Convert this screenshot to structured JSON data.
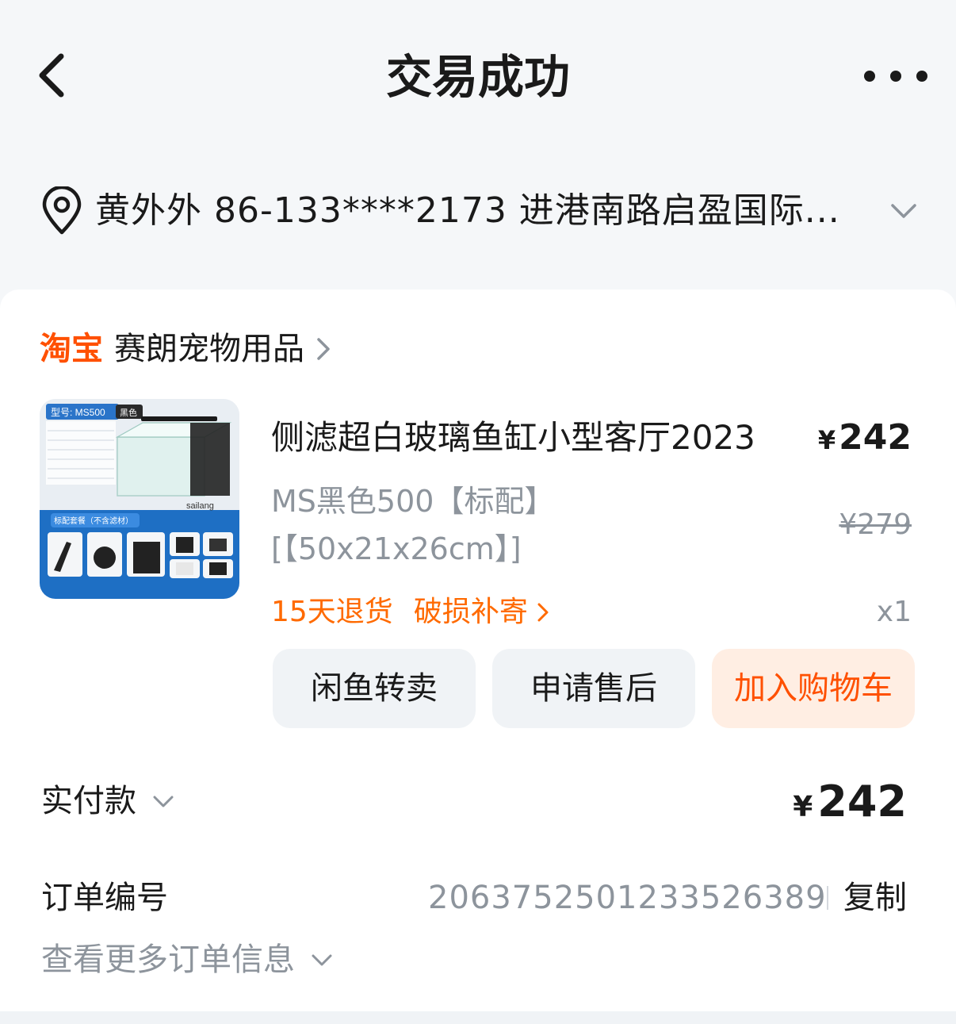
{
  "header": {
    "title": "交易成功"
  },
  "address": {
    "text": "黄外外  86-133****2173  进港南路启盈国际..."
  },
  "shop": {
    "brand": "淘宝",
    "name": "赛朗宠物用品"
  },
  "product": {
    "name": "侧滤超白玻璃鱼缸小型客厅2023",
    "price_currency": "¥",
    "price": "242",
    "spec": "MS黑色500【标配】[【50x21x26cm】]",
    "original_price": "¥279",
    "services": [
      "15天退货",
      "破损补寄"
    ],
    "quantity": "x1",
    "thumbnail": {
      "model_label": "型号: MS500",
      "color_tag": "黑色",
      "package_label": "标配套餐（不含滤材）",
      "brand": "sailang"
    }
  },
  "actions": {
    "resell": "闲鱼转卖",
    "after_sale": "申请售后",
    "add_to_cart": "加入购物车"
  },
  "payment": {
    "label": "实付款",
    "currency": "¥",
    "amount": "242"
  },
  "order": {
    "label": "订单编号",
    "number": "2063752501233526389",
    "copy": "复制",
    "more_info": "查看更多订单信息"
  },
  "colors": {
    "accent": "#ff5000",
    "muted": "#8d949c",
    "background": "#f5f7f9"
  }
}
